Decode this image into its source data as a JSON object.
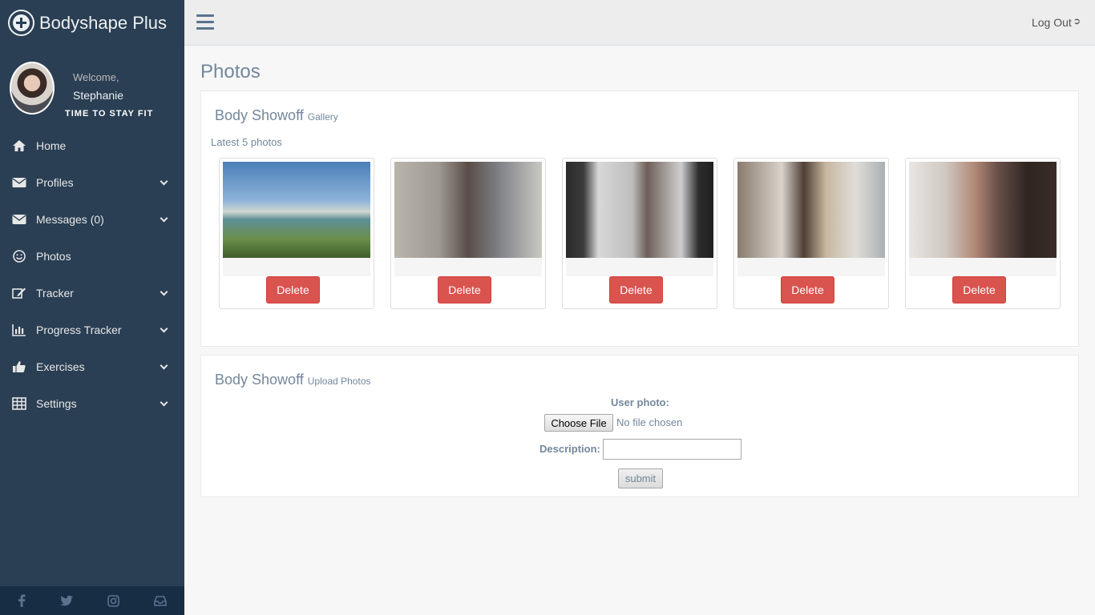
{
  "brand": {
    "title": "Bodyshape Plus",
    "logo_icon": "plus-circle-icon"
  },
  "profile": {
    "welcome": "Welcome,",
    "name": "Stephanie",
    "tagline": "TIME TO STAY FIT"
  },
  "sidebar": {
    "items": [
      {
        "label": "Home",
        "icon": "home-icon",
        "has_submenu": false
      },
      {
        "label": "Profiles",
        "icon": "envelope-icon",
        "has_submenu": true
      },
      {
        "label": "Messages (0)",
        "icon": "envelope-icon",
        "has_submenu": true
      },
      {
        "label": "Photos",
        "icon": "smile-icon",
        "has_submenu": false
      },
      {
        "label": "Tracker",
        "icon": "edit-icon",
        "has_submenu": true
      },
      {
        "label": "Progress Tracker",
        "icon": "bar-chart-icon",
        "has_submenu": true
      },
      {
        "label": "Exercises",
        "icon": "thumbs-up-icon",
        "has_submenu": true
      },
      {
        "label": "Settings",
        "icon": "table-icon",
        "has_submenu": true
      }
    ],
    "footer_icons": [
      "facebook-icon",
      "twitter-icon",
      "instagram-icon",
      "inbox-icon"
    ]
  },
  "topnav": {
    "logout_label": "Log Out"
  },
  "page": {
    "title": "Photos"
  },
  "gallery": {
    "title": "Body Showoff",
    "subtitle": "Gallery",
    "latest_label": "Latest 5 photos",
    "delete_label": "Delete",
    "photo_count": 5
  },
  "upload": {
    "title": "Body Showoff",
    "subtitle": "Upload Photos",
    "user_photo_label": "User photo:",
    "choose_file_label": "Choose File",
    "no_file_text": "No file chosen",
    "description_label": "Description:",
    "description_value": "",
    "submit_label": "submit"
  },
  "colors": {
    "sidebar_bg": "#2a3f54",
    "sidebar_footer_bg": "#172d44",
    "delete_button": "#d9534f",
    "text_muted": "#73879c"
  }
}
